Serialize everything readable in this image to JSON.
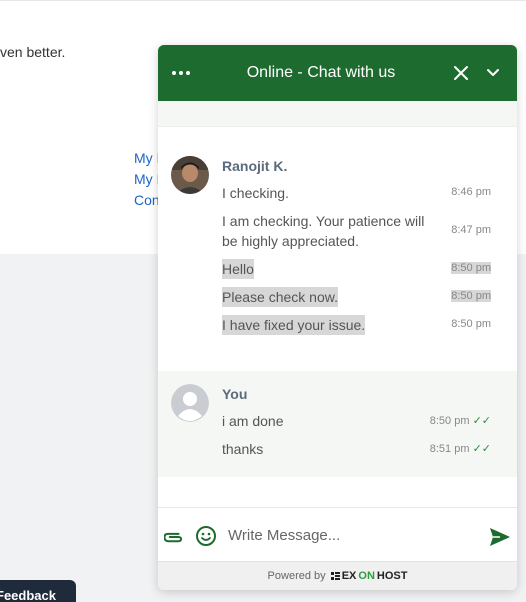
{
  "page": {
    "partial_text": "ven better.",
    "links": [
      "My I",
      "My I",
      "Con"
    ],
    "feedback_label": "Feedback"
  },
  "chat": {
    "header": {
      "title": "Online - Chat with us",
      "more_icon": "more-horizontal-icon",
      "close_icon": "close-icon",
      "minimize_icon": "chevron-down-icon",
      "color": "#1d6b2f"
    },
    "agent": {
      "name": "Ranojit K.",
      "messages": [
        {
          "text": "I checking.",
          "time": "8:46 pm",
          "highlight": false
        },
        {
          "text": "I am checking. Your patience will be highly appreciated.",
          "time": "8:47 pm",
          "highlight": false
        },
        {
          "text": "Hello",
          "time": "8:50 pm",
          "highlight": true
        },
        {
          "text": "Please check now.",
          "time": "8:50 pm",
          "highlight": true
        },
        {
          "text": "I have fixed your issue.",
          "time": "8:50 pm",
          "highlight": true
        }
      ]
    },
    "me": {
      "name": "You",
      "messages": [
        {
          "text": "i am done",
          "time": "8:50 pm",
          "status": "✓✓"
        },
        {
          "text": "thanks",
          "time": "8:51 pm",
          "status": "✓✓"
        }
      ]
    },
    "composer": {
      "placeholder": "Write Message...",
      "attach_icon": "paperclip-icon",
      "emoji_icon": "smiley-icon",
      "send_icon": "send-icon"
    },
    "powered_by": "Powered by",
    "brand": {
      "part1": "EX",
      "part2": "ON",
      "part3": "HOST"
    },
    "accent_color": "#2e8a3e"
  }
}
